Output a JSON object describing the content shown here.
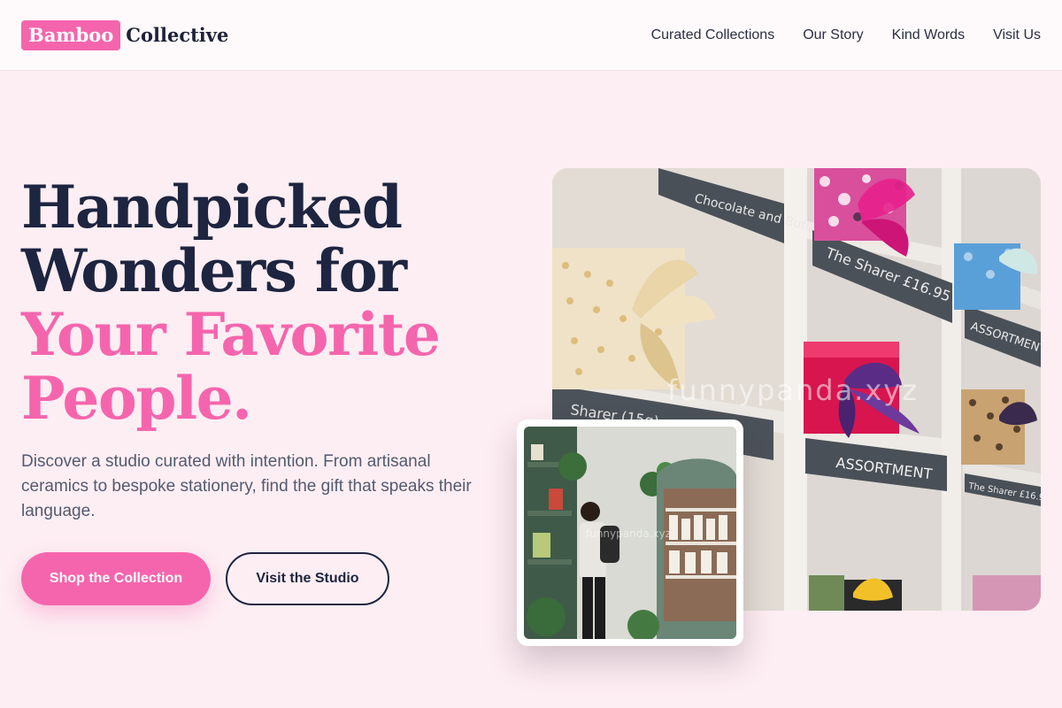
{
  "header": {
    "logo_mark": "Bamboo",
    "logo_word": "Collective",
    "nav": [
      {
        "label": "Curated Collections"
      },
      {
        "label": "Our Story"
      },
      {
        "label": "Kind Words"
      },
      {
        "label": "Visit Us"
      }
    ]
  },
  "hero": {
    "title_lines": [
      "Handpicked",
      "Wonders for",
      "Your Favorite",
      "People."
    ],
    "description": "Discover a studio curated with intention. From artisanal ceramics to bespoke stationery, find the gift that speaks their language.",
    "primary_button": "Shop the Collection",
    "secondary_button": "Visit the Studio"
  },
  "photos": {
    "main_alt": "gift boxes on white shelves with chalkboard labels",
    "main_watermark": "funnypanda.xyz",
    "shelf_labels": [
      "Chocolate and Butterscotch",
      "The Sharer £16.95",
      "ASSORTMENT ♡",
      "Sharer (15g)",
      "ASSORTMENT",
      "The Sharer £16.95"
    ],
    "inset_alt": "person browsing shelves inside a gift shop",
    "inset_watermark": "funnypanda.xyz"
  },
  "colors": {
    "accent": "#f565ad",
    "dark": "#1d2540",
    "background": "#fdeef3"
  }
}
